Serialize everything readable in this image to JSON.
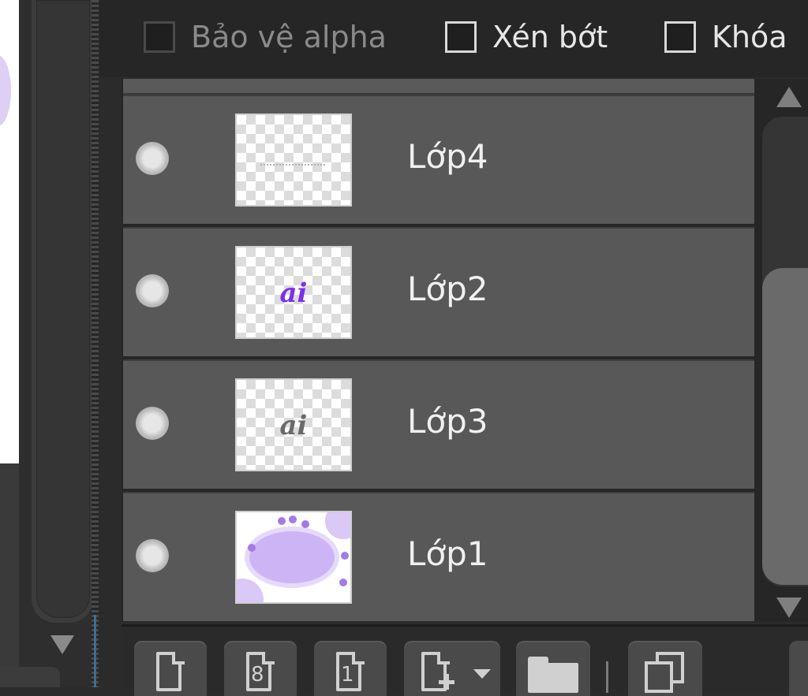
{
  "options": {
    "alpha_protect": {
      "label": "Bảo vệ alpha",
      "checked": false,
      "enabled": false
    },
    "clip": {
      "label": "Xén bớt",
      "checked": false,
      "enabled": true
    },
    "lock": {
      "label": "Khóa",
      "checked": false,
      "enabled": true
    }
  },
  "layers": [
    {
      "name": "Lớp4",
      "visible": true,
      "thumbnail": "dashed-line"
    },
    {
      "name": "Lớp2",
      "visible": true,
      "thumbnail": "purple-text",
      "thumb_text": "ai",
      "thumb_color": "#7b2ff0"
    },
    {
      "name": "Lớp3",
      "visible": true,
      "thumbnail": "gray-text",
      "thumb_text": "ai",
      "thumb_color": "#6a6a6a"
    },
    {
      "name": "Lớp1",
      "visible": true,
      "thumbnail": "purple-oval-art"
    }
  ],
  "toolbar": {
    "buttons": [
      {
        "icon": "new-layer-icon"
      },
      {
        "icon": "new-8bit-layer-icon",
        "glyph": "8"
      },
      {
        "icon": "new-1bit-layer-icon",
        "glyph": "1"
      },
      {
        "icon": "new-layer-dropdown-icon"
      },
      {
        "icon": "new-folder-icon"
      },
      {
        "icon": "duplicate-layer-icon"
      }
    ]
  },
  "colors": {
    "panel_bg": "#262626",
    "row_bg": "#585858",
    "text": "#e6e6e6",
    "accent_purple": "#7b2ff0"
  }
}
